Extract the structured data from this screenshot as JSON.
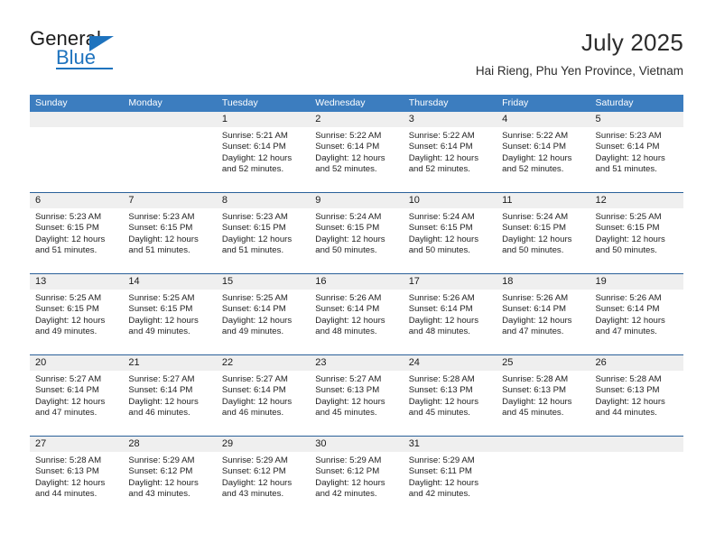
{
  "logo": {
    "word_one": "General",
    "word_two": "Blue",
    "triangle_icon": "blue-triangle-icon",
    "brand_color": "#1e73be"
  },
  "header": {
    "title": "July 2025",
    "subtitle": "Hai Rieng, Phu Yen Province, Vietnam"
  },
  "calendar": {
    "header_bg": "#3c7dbf",
    "row_rule_color": "#2a6099",
    "datenum_bg": "#efefef",
    "weekdays": [
      "Sunday",
      "Monday",
      "Tuesday",
      "Wednesday",
      "Thursday",
      "Friday",
      "Saturday"
    ],
    "weeks": [
      [
        {
          "day": "",
          "lines": []
        },
        {
          "day": "",
          "lines": []
        },
        {
          "day": "1",
          "lines": [
            "Sunrise: 5:21 AM",
            "Sunset: 6:14 PM",
            "Daylight: 12 hours",
            "and 52 minutes."
          ]
        },
        {
          "day": "2",
          "lines": [
            "Sunrise: 5:22 AM",
            "Sunset: 6:14 PM",
            "Daylight: 12 hours",
            "and 52 minutes."
          ]
        },
        {
          "day": "3",
          "lines": [
            "Sunrise: 5:22 AM",
            "Sunset: 6:14 PM",
            "Daylight: 12 hours",
            "and 52 minutes."
          ]
        },
        {
          "day": "4",
          "lines": [
            "Sunrise: 5:22 AM",
            "Sunset: 6:14 PM",
            "Daylight: 12 hours",
            "and 52 minutes."
          ]
        },
        {
          "day": "5",
          "lines": [
            "Sunrise: 5:23 AM",
            "Sunset: 6:14 PM",
            "Daylight: 12 hours",
            "and 51 minutes."
          ]
        }
      ],
      [
        {
          "day": "6",
          "lines": [
            "Sunrise: 5:23 AM",
            "Sunset: 6:15 PM",
            "Daylight: 12 hours",
            "and 51 minutes."
          ]
        },
        {
          "day": "7",
          "lines": [
            "Sunrise: 5:23 AM",
            "Sunset: 6:15 PM",
            "Daylight: 12 hours",
            "and 51 minutes."
          ]
        },
        {
          "day": "8",
          "lines": [
            "Sunrise: 5:23 AM",
            "Sunset: 6:15 PM",
            "Daylight: 12 hours",
            "and 51 minutes."
          ]
        },
        {
          "day": "9",
          "lines": [
            "Sunrise: 5:24 AM",
            "Sunset: 6:15 PM",
            "Daylight: 12 hours",
            "and 50 minutes."
          ]
        },
        {
          "day": "10",
          "lines": [
            "Sunrise: 5:24 AM",
            "Sunset: 6:15 PM",
            "Daylight: 12 hours",
            "and 50 minutes."
          ]
        },
        {
          "day": "11",
          "lines": [
            "Sunrise: 5:24 AM",
            "Sunset: 6:15 PM",
            "Daylight: 12 hours",
            "and 50 minutes."
          ]
        },
        {
          "day": "12",
          "lines": [
            "Sunrise: 5:25 AM",
            "Sunset: 6:15 PM",
            "Daylight: 12 hours",
            "and 50 minutes."
          ]
        }
      ],
      [
        {
          "day": "13",
          "lines": [
            "Sunrise: 5:25 AM",
            "Sunset: 6:15 PM",
            "Daylight: 12 hours",
            "and 49 minutes."
          ]
        },
        {
          "day": "14",
          "lines": [
            "Sunrise: 5:25 AM",
            "Sunset: 6:15 PM",
            "Daylight: 12 hours",
            "and 49 minutes."
          ]
        },
        {
          "day": "15",
          "lines": [
            "Sunrise: 5:25 AM",
            "Sunset: 6:14 PM",
            "Daylight: 12 hours",
            "and 49 minutes."
          ]
        },
        {
          "day": "16",
          "lines": [
            "Sunrise: 5:26 AM",
            "Sunset: 6:14 PM",
            "Daylight: 12 hours",
            "and 48 minutes."
          ]
        },
        {
          "day": "17",
          "lines": [
            "Sunrise: 5:26 AM",
            "Sunset: 6:14 PM",
            "Daylight: 12 hours",
            "and 48 minutes."
          ]
        },
        {
          "day": "18",
          "lines": [
            "Sunrise: 5:26 AM",
            "Sunset: 6:14 PM",
            "Daylight: 12 hours",
            "and 47 minutes."
          ]
        },
        {
          "day": "19",
          "lines": [
            "Sunrise: 5:26 AM",
            "Sunset: 6:14 PM",
            "Daylight: 12 hours",
            "and 47 minutes."
          ]
        }
      ],
      [
        {
          "day": "20",
          "lines": [
            "Sunrise: 5:27 AM",
            "Sunset: 6:14 PM",
            "Daylight: 12 hours",
            "and 47 minutes."
          ]
        },
        {
          "day": "21",
          "lines": [
            "Sunrise: 5:27 AM",
            "Sunset: 6:14 PM",
            "Daylight: 12 hours",
            "and 46 minutes."
          ]
        },
        {
          "day": "22",
          "lines": [
            "Sunrise: 5:27 AM",
            "Sunset: 6:14 PM",
            "Daylight: 12 hours",
            "and 46 minutes."
          ]
        },
        {
          "day": "23",
          "lines": [
            "Sunrise: 5:27 AM",
            "Sunset: 6:13 PM",
            "Daylight: 12 hours",
            "and 45 minutes."
          ]
        },
        {
          "day": "24",
          "lines": [
            "Sunrise: 5:28 AM",
            "Sunset: 6:13 PM",
            "Daylight: 12 hours",
            "and 45 minutes."
          ]
        },
        {
          "day": "25",
          "lines": [
            "Sunrise: 5:28 AM",
            "Sunset: 6:13 PM",
            "Daylight: 12 hours",
            "and 45 minutes."
          ]
        },
        {
          "day": "26",
          "lines": [
            "Sunrise: 5:28 AM",
            "Sunset: 6:13 PM",
            "Daylight: 12 hours",
            "and 44 minutes."
          ]
        }
      ],
      [
        {
          "day": "27",
          "lines": [
            "Sunrise: 5:28 AM",
            "Sunset: 6:13 PM",
            "Daylight: 12 hours",
            "and 44 minutes."
          ]
        },
        {
          "day": "28",
          "lines": [
            "Sunrise: 5:29 AM",
            "Sunset: 6:12 PM",
            "Daylight: 12 hours",
            "and 43 minutes."
          ]
        },
        {
          "day": "29",
          "lines": [
            "Sunrise: 5:29 AM",
            "Sunset: 6:12 PM",
            "Daylight: 12 hours",
            "and 43 minutes."
          ]
        },
        {
          "day": "30",
          "lines": [
            "Sunrise: 5:29 AM",
            "Sunset: 6:12 PM",
            "Daylight: 12 hours",
            "and 42 minutes."
          ]
        },
        {
          "day": "31",
          "lines": [
            "Sunrise: 5:29 AM",
            "Sunset: 6:11 PM",
            "Daylight: 12 hours",
            "and 42 minutes."
          ]
        },
        {
          "day": "",
          "lines": []
        },
        {
          "day": "",
          "lines": []
        }
      ]
    ]
  }
}
